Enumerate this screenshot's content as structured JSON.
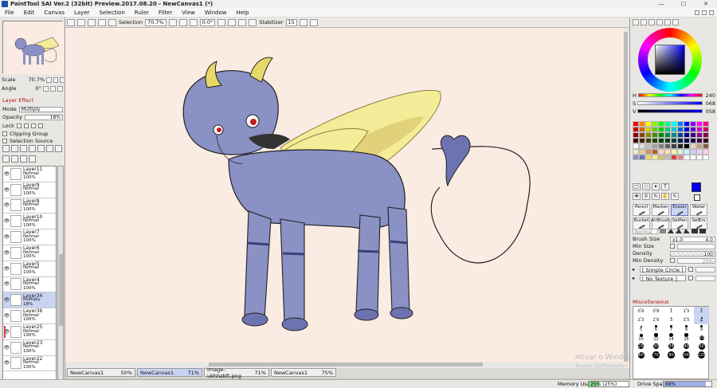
{
  "window": {
    "title": "PaintTool SAI Ver.2 (32bit) Preview.2017.08.20 - NewCanvas1 (*)",
    "controls": [
      "—",
      "☐",
      "✕"
    ]
  },
  "menu": [
    "File",
    "Edit",
    "Canvas",
    "Layer",
    "Selection",
    "Ruler",
    "Filter",
    "View",
    "Window",
    "Help"
  ],
  "toolbar": {
    "selection_label": "Selection",
    "zoom": "70.7%",
    "rotation": "0.0°",
    "stabilizer_label": "Stabilizer",
    "stabilizer_value": "15"
  },
  "navigator": {
    "scale_label": "Scale",
    "scale_value": "70.7%",
    "angle_label": "Angle",
    "angle_value": "0°"
  },
  "layer_props": {
    "section": "Layer Effect",
    "mode_label": "Mode",
    "mode_value": "Multiply",
    "opacity_label": "Opacity",
    "opacity_value": "18%",
    "lock_label": "Lock",
    "clipping_label": "Clipping Group",
    "selection_source_label": "Selection Source"
  },
  "layers": [
    {
      "name": "Layer11",
      "mode": "Normal",
      "opacity": "100%",
      "active": false,
      "marked": false
    },
    {
      "name": "Layer9",
      "mode": "Normal",
      "opacity": "100%",
      "active": false,
      "marked": false
    },
    {
      "name": "Layer8",
      "mode": "Normal",
      "opacity": "100%",
      "active": false,
      "marked": false
    },
    {
      "name": "Layer10",
      "mode": "Normal",
      "opacity": "100%",
      "active": false,
      "marked": false
    },
    {
      "name": "Layer7",
      "mode": "Normal",
      "opacity": "100%",
      "active": false,
      "marked": false
    },
    {
      "name": "Layer6",
      "mode": "Normal",
      "opacity": "100%",
      "active": false,
      "marked": false
    },
    {
      "name": "Layer5",
      "mode": "Normal",
      "opacity": "100%",
      "active": false,
      "marked": false
    },
    {
      "name": "Layer4",
      "mode": "Normal",
      "opacity": "100%",
      "active": false,
      "marked": false
    },
    {
      "name": "Layer34",
      "mode": "Multiply",
      "opacity": "18%",
      "active": true,
      "marked": false
    },
    {
      "name": "Layer36",
      "mode": "Normal",
      "opacity": "100%",
      "active": false,
      "marked": false
    },
    {
      "name": "Layer25",
      "mode": "Normal",
      "opacity": "100%",
      "active": false,
      "marked": true
    },
    {
      "name": "Layer23",
      "mode": "Normal",
      "opacity": "100%",
      "active": false,
      "marked": false
    },
    {
      "name": "Layer22",
      "mode": "Normal",
      "opacity": "100%",
      "active": false,
      "marked": false
    }
  ],
  "tabs": [
    {
      "name": "NewCanvas1",
      "zoom": "50%",
      "active": false
    },
    {
      "name": "NewCanvas1",
      "zoom": "71%",
      "active": true
    },
    {
      "name": "image-ukhhzbft.png",
      "zoom": "71%",
      "active": false
    },
    {
      "name": "NewCanvas1",
      "zoom": "75%",
      "active": false
    }
  ],
  "status": {
    "memory_label": "Memory Usage",
    "memory_value": "25% (25%)",
    "memory_fraction": 0.25,
    "drive_label": "Drive Space",
    "drive_value": "88%",
    "drive_fraction": 0.88
  },
  "watermark": {
    "line1": "Ativar o Windows",
    "line2": "Acesse Configurações"
  },
  "color": {
    "h_label": "H",
    "h_value": "240",
    "s_label": "S",
    "s_value": "068",
    "v_label": "V",
    "v_value": "058",
    "foreground": "#0000f0",
    "palette": [
      "#ff0000",
      "#ff8000",
      "#ffff00",
      "#80ff00",
      "#00ff00",
      "#00ff80",
      "#00ffff",
      "#0080ff",
      "#0000ff",
      "#8000ff",
      "#ff00ff",
      "#ff0080",
      "#cc0000",
      "#cc6600",
      "#cccc00",
      "#66cc00",
      "#00cc00",
      "#00cc66",
      "#00cccc",
      "#0066cc",
      "#0000cc",
      "#6600cc",
      "#cc00cc",
      "#cc0066",
      "#880000",
      "#884400",
      "#888800",
      "#448800",
      "#008800",
      "#008844",
      "#008888",
      "#004488",
      "#000088",
      "#440088",
      "#880088",
      "#880044",
      "#400000",
      "#402000",
      "#404000",
      "#204000",
      "#004000",
      "#004020",
      "#004040",
      "#002040",
      "#000040",
      "#200040",
      "#400040",
      "#400020",
      "#ffffff",
      "#e0e0e0",
      "#c0c0c0",
      "#a0a0a0",
      "#808080",
      "#606060",
      "#404040",
      "#202020",
      "#000000",
      "#f0d0c0",
      "#c0a080",
      "#806040",
      "#f5e6c8",
      "#e8c8a0",
      "#d09060",
      "#b06030",
      "#ffd0d0",
      "#ffe0b0",
      "#fff0b0",
      "#d0ffd0",
      "#d0f0ff",
      "#d0d0ff",
      "#f0d0ff",
      "#ffd0f0",
      "#8a91c4",
      "#6870b0",
      "#e8d868",
      "#f5ec9a",
      "#d4c068",
      "#bdbdbd",
      "#d44040",
      "#e08080",
      "#ffffff",
      "#ffffff",
      "#ffffff",
      "#ffffff"
    ]
  },
  "brushes": [
    {
      "name": "Pencil",
      "active": false
    },
    {
      "name": "Marker",
      "active": false
    },
    {
      "name": "Eraser",
      "active": true
    },
    {
      "name": "Water",
      "active": false
    },
    {
      "name": "Bucket",
      "active": false
    },
    {
      "name": "AirBrush",
      "active": false
    },
    {
      "name": "SelPen",
      "active": false
    },
    {
      "name": "SelErs",
      "active": false
    }
  ],
  "brush_settings": {
    "shape_placeholder": "Normal",
    "size_label": "Brush Size",
    "size_mult": "x1.0",
    "size_value": "4.0",
    "min_size_label": "Min Size",
    "min_size_value": "",
    "density_label": "Density",
    "density_value": "100",
    "min_density_label": "Min Density",
    "min_density_value": "25%",
    "circle_label": "[ Simple Circle ]",
    "texture_label": "[ No Texture ]",
    "misc_label": "Miscellaneous"
  },
  "brush_sizes": [
    {
      "label": "0.6",
      "d": 0
    },
    {
      "label": "0.8",
      "d": 0
    },
    {
      "label": "1",
      "d": 0
    },
    {
      "label": "1.5",
      "d": 0
    },
    {
      "label": "2",
      "d": 0
    },
    {
      "label": "2.3",
      "d": 1
    },
    {
      "label": "2.6",
      "d": 1
    },
    {
      "label": "3",
      "d": 1.5
    },
    {
      "label": "3.5",
      "d": 1.5
    },
    {
      "label": "4",
      "d": 2
    },
    {
      "label": "5",
      "d": 2
    },
    {
      "label": "6",
      "d": 2.5
    },
    {
      "label": "7",
      "d": 3
    },
    {
      "label": "8",
      "d": 3
    },
    {
      "label": "9",
      "d": 3.5
    },
    {
      "label": "10",
      "d": 4
    },
    {
      "label": "12",
      "d": 4.5
    },
    {
      "label": "14",
      "d": 5
    },
    {
      "label": "16",
      "d": 5.5
    },
    {
      "label": "20",
      "d": 6
    },
    {
      "label": "25",
      "d": 6.5
    },
    {
      "label": "30",
      "d": 7
    },
    {
      "label": "35",
      "d": 7
    },
    {
      "label": "40",
      "d": 7.5
    },
    {
      "label": "50",
      "d": 8
    },
    {
      "label": "60",
      "d": 8
    },
    {
      "label": "70",
      "d": 8.5
    },
    {
      "label": "80",
      "d": 8.5
    },
    {
      "label": "100",
      "d": 9
    },
    {
      "label": "120",
      "d": 9
    }
  ]
}
